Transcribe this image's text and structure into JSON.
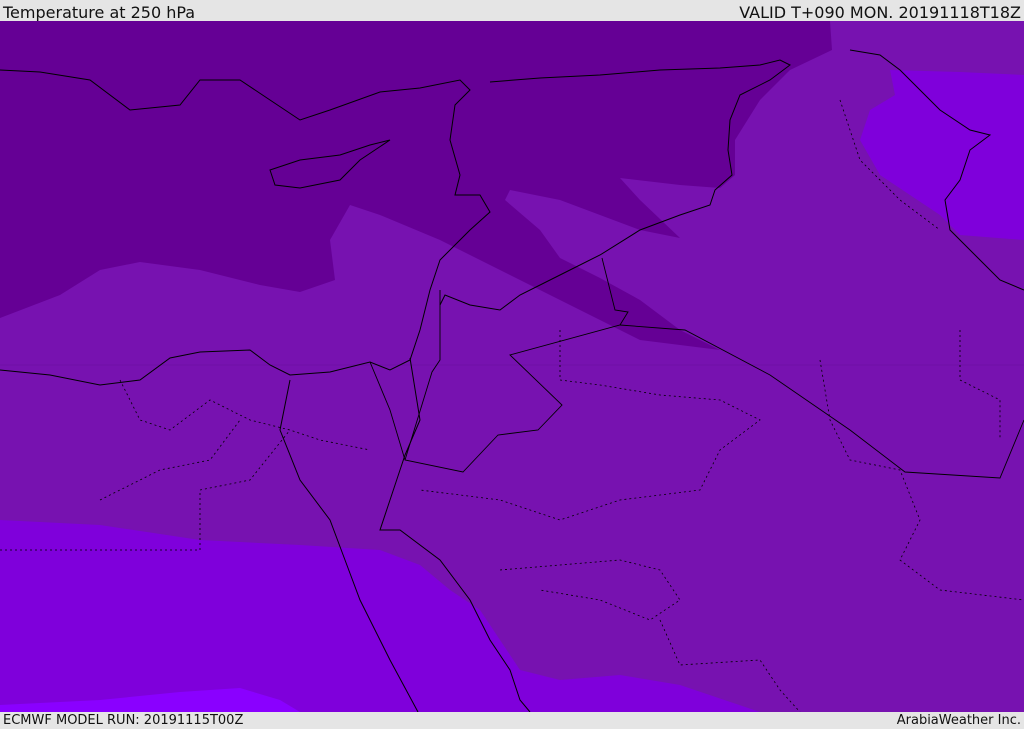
{
  "header": {
    "title": "Temperature at 250 hPa",
    "valid": "VALID T+090 MON. 20191118T18Z"
  },
  "footer": {
    "model_run": "ECMWF MODEL RUN: 20191115T00Z",
    "credit": "ArabiaWeather Inc."
  },
  "colors": {
    "band_coldest": "#650095",
    "band_cold": "#7712b0",
    "band_mid": "#7f00db",
    "band_warm": "#8a00ff",
    "coastline": "#000000"
  }
}
